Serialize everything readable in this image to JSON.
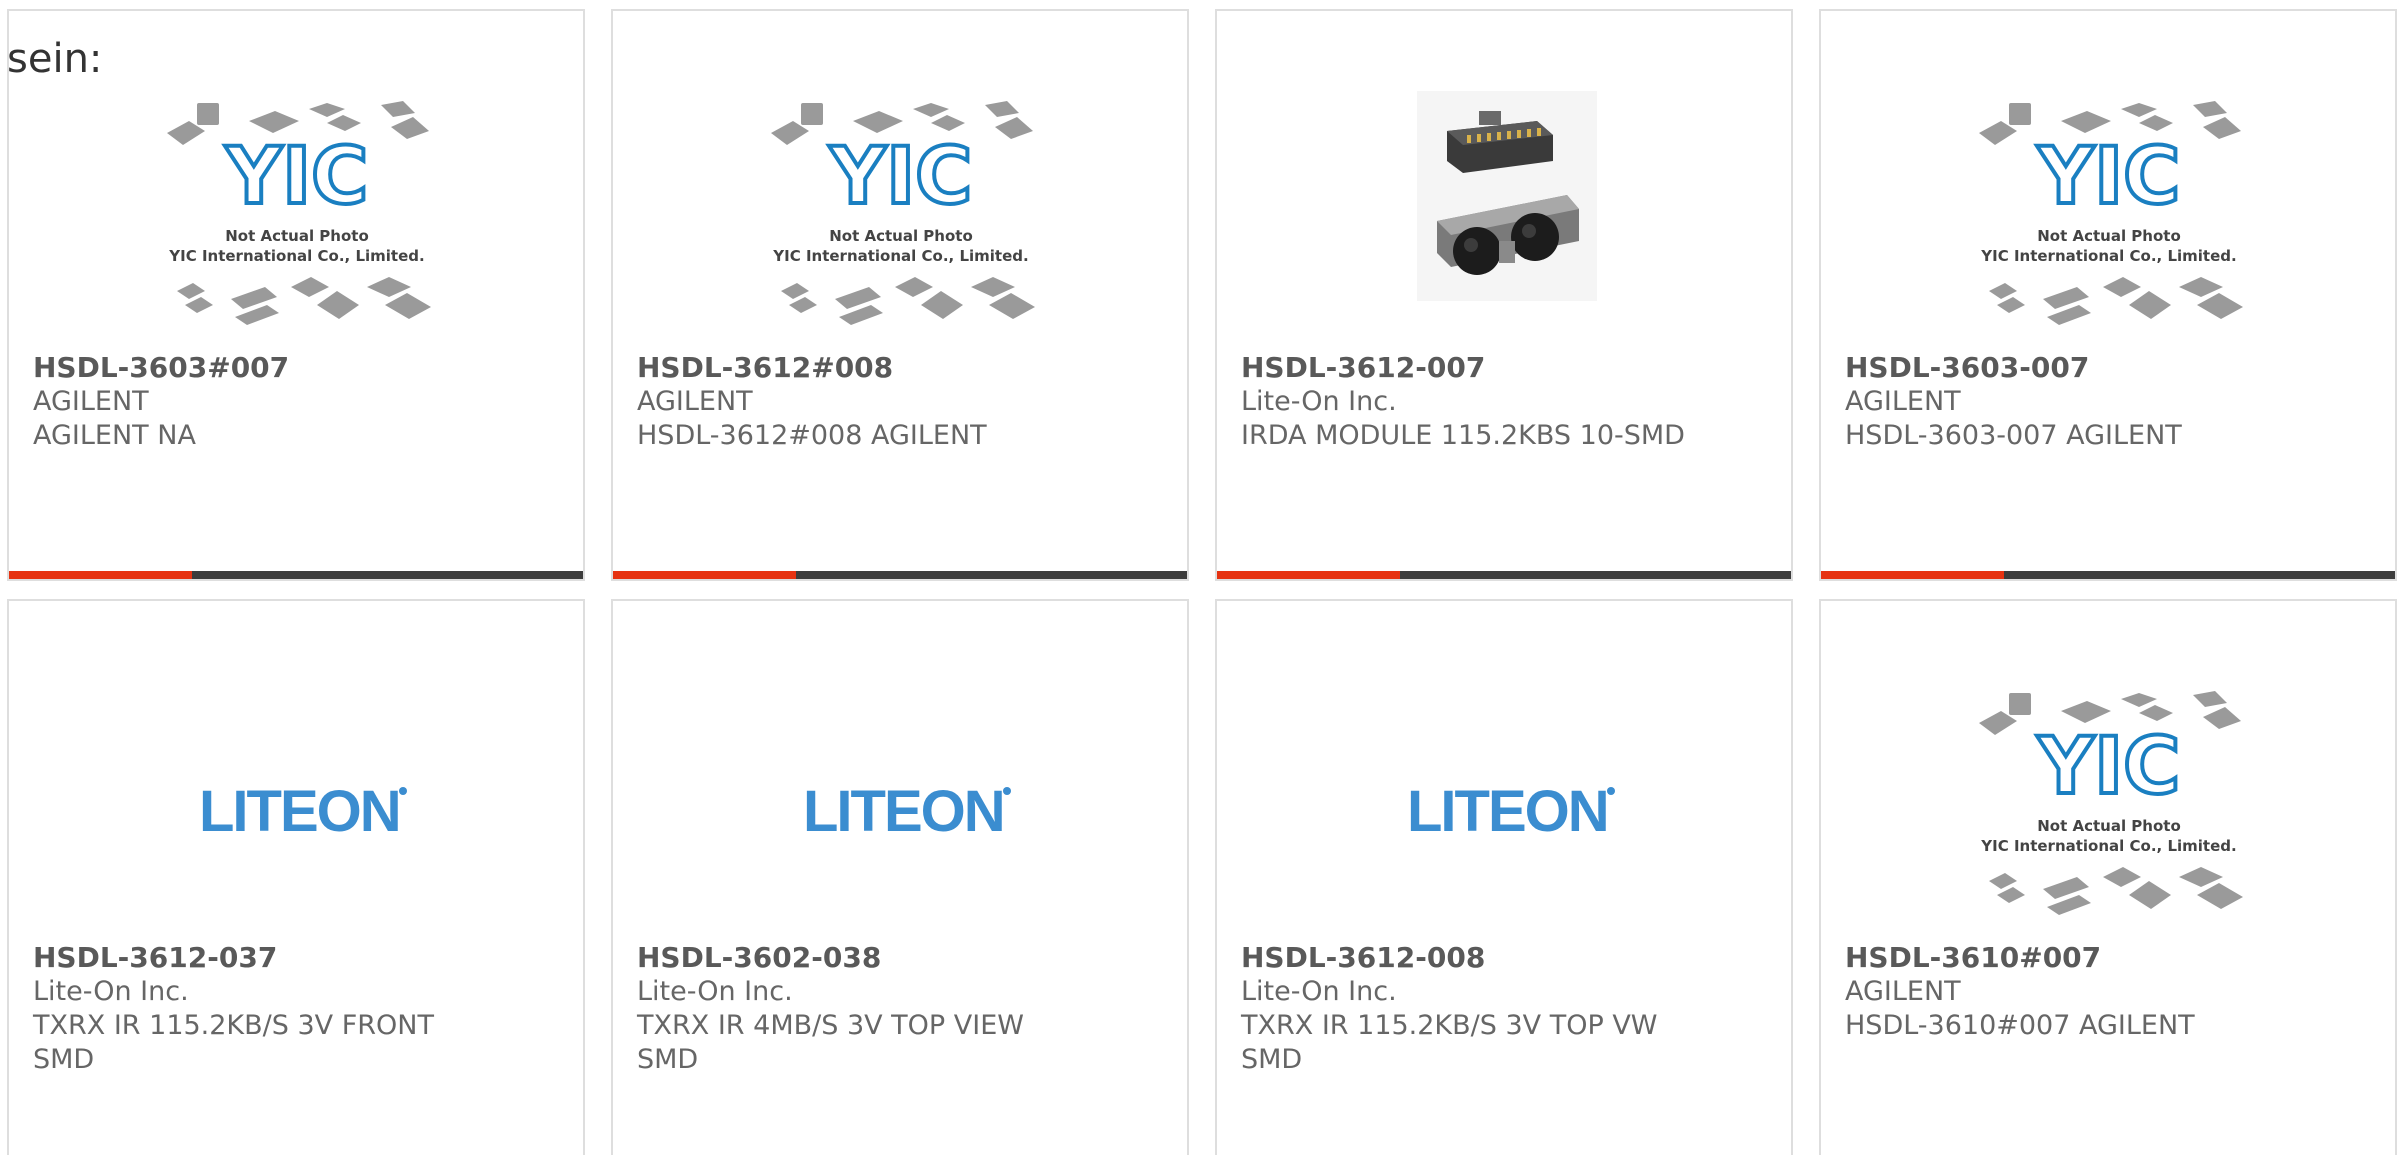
{
  "intro_text": "sein:",
  "placeholder": {
    "brand": "YIC",
    "caption_line1": "Not Actual Photo",
    "caption_line2": "YIC International Co., Limited."
  },
  "liteon_logo_text": "LITEON",
  "colors": {
    "accent_bar": "#e63312",
    "dark_bar": "#3c3c3c",
    "part_text": "#595959",
    "yic_blue": "#1a7fc1",
    "liteon_blue": "#3b8dd0"
  },
  "products": [
    {
      "part": "HSDL-3603#007",
      "maker": "AGILENT",
      "desc": "AGILENT NA",
      "image": "yic-placeholder"
    },
    {
      "part": "HSDL-3612#008",
      "maker": "AGILENT",
      "desc": "HSDL-3612#008 AGILENT",
      "image": "yic-placeholder"
    },
    {
      "part": "HSDL-3612-007",
      "maker": "Lite-On Inc.",
      "desc": "IRDA MODULE 115.2KBS 10-SMD",
      "image": "irda-module-photo"
    },
    {
      "part": "HSDL-3603-007",
      "maker": "AGILENT",
      "desc": "HSDL-3603-007 AGILENT",
      "image": "yic-placeholder"
    },
    {
      "part": "HSDL-3612-037",
      "maker": "Lite-On Inc.",
      "desc": "TXRX IR 115.2KB/S 3V FRONT\nSMD",
      "image": "liteon-logo"
    },
    {
      "part": "HSDL-3602-038",
      "maker": "Lite-On Inc.",
      "desc": "TXRX IR 4MB/S 3V TOP VIEW\nSMD",
      "image": "liteon-logo"
    },
    {
      "part": "HSDL-3612-008",
      "maker": "Lite-On Inc.",
      "desc": "TXRX IR 115.2KB/S 3V TOP VW\nSMD",
      "image": "liteon-logo"
    },
    {
      "part": "HSDL-3610#007",
      "maker": "AGILENT",
      "desc": "HSDL-3610#007 AGILENT",
      "image": "yic-placeholder"
    }
  ]
}
